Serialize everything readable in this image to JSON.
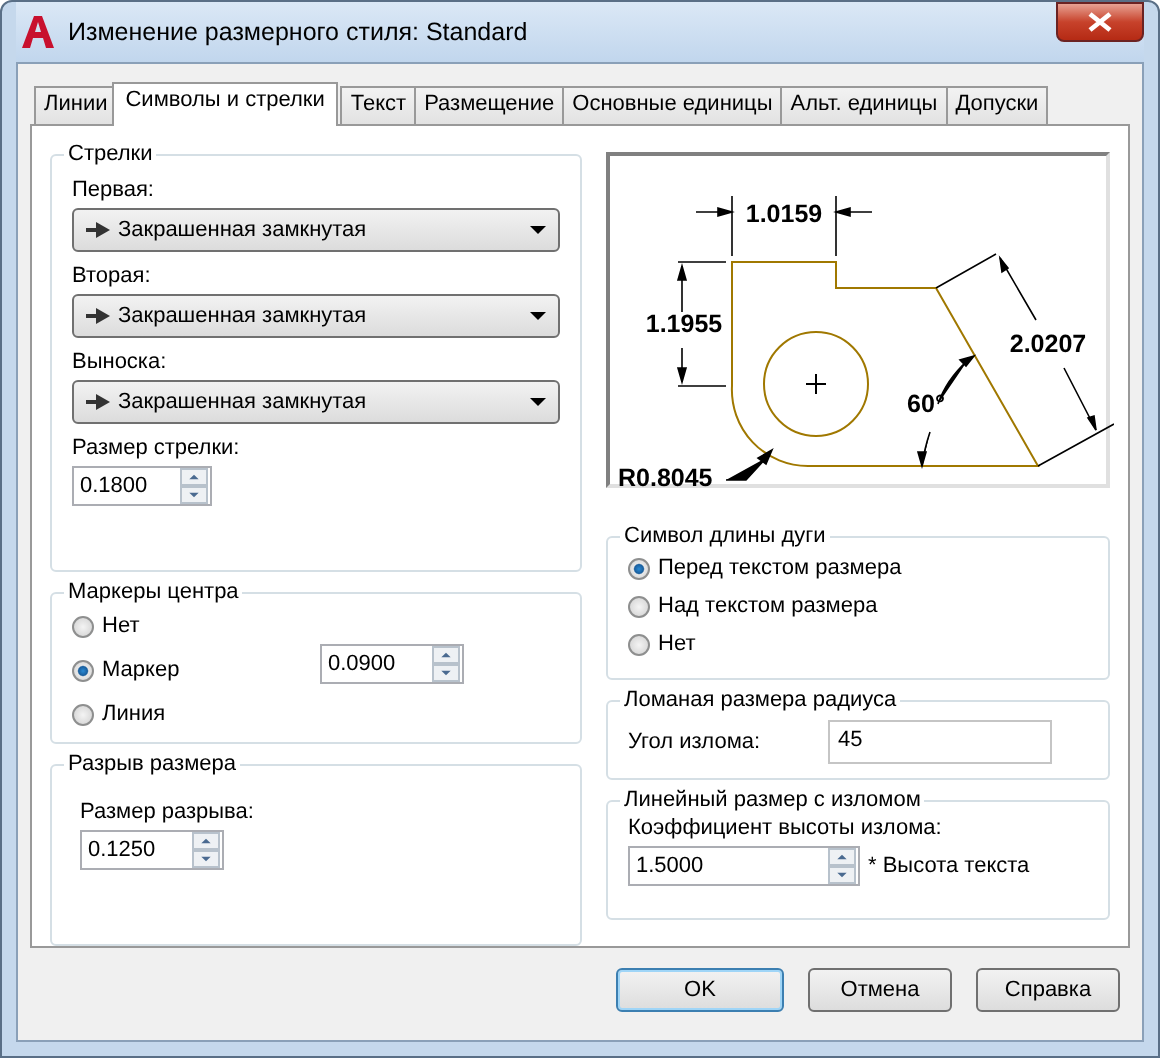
{
  "window": {
    "title": "Изменение размерного стиля: Standard"
  },
  "tabs": [
    {
      "label": "Линии",
      "selected": false
    },
    {
      "label": "Символы и стрелки",
      "selected": true
    },
    {
      "label": "Текст",
      "selected": false
    },
    {
      "label": "Размещение",
      "selected": false
    },
    {
      "label": "Основные единицы",
      "selected": false
    },
    {
      "label": "Альт. единицы",
      "selected": false
    },
    {
      "label": "Допуски",
      "selected": false
    }
  ],
  "arrowheads": {
    "title": "Стрелки",
    "selects": [
      {
        "label": "Первая:",
        "value": "Закрашенная замкнутая"
      },
      {
        "label": "Вторая:",
        "value": "Закрашенная замкнутая"
      },
      {
        "label": "Выноска:",
        "value": "Закрашенная замкнутая"
      }
    ],
    "size": {
      "label": "Размер стрелки:",
      "value": "0.1800"
    }
  },
  "center_marks": {
    "title": "Маркеры центра",
    "options": [
      {
        "label": "Нет",
        "selected": false
      },
      {
        "label": "Маркер",
        "selected": true
      },
      {
        "label": "Линия",
        "selected": false
      }
    ],
    "size": "0.0900"
  },
  "dimension_break": {
    "title": "Разрыв размера",
    "label": "Размер разрыва:",
    "value": "0.1250"
  },
  "preview": {
    "labels": [
      "1.0159",
      "1.1955",
      "2.0207",
      "60°",
      "R0.8045"
    ]
  },
  "arc_length_symbol": {
    "title": "Символ длины дуги",
    "options": [
      {
        "label": "Перед текстом размера",
        "selected": true
      },
      {
        "label": "Над текстом размера",
        "selected": false
      },
      {
        "label": "Нет",
        "selected": false
      }
    ]
  },
  "radius_jog": {
    "title": "Ломаная размера радиуса",
    "label": "Угол излома:",
    "value": "45"
  },
  "linear_jog": {
    "title": "Линейный размер с изломом",
    "label": "Коэффициент высоты излома:",
    "value": "1.5000",
    "suffix": "* Высота текста"
  },
  "buttons": [
    {
      "label": "OK",
      "default": true
    },
    {
      "label": "Отмена",
      "default": false
    },
    {
      "label": "Справка",
      "default": false
    }
  ]
}
